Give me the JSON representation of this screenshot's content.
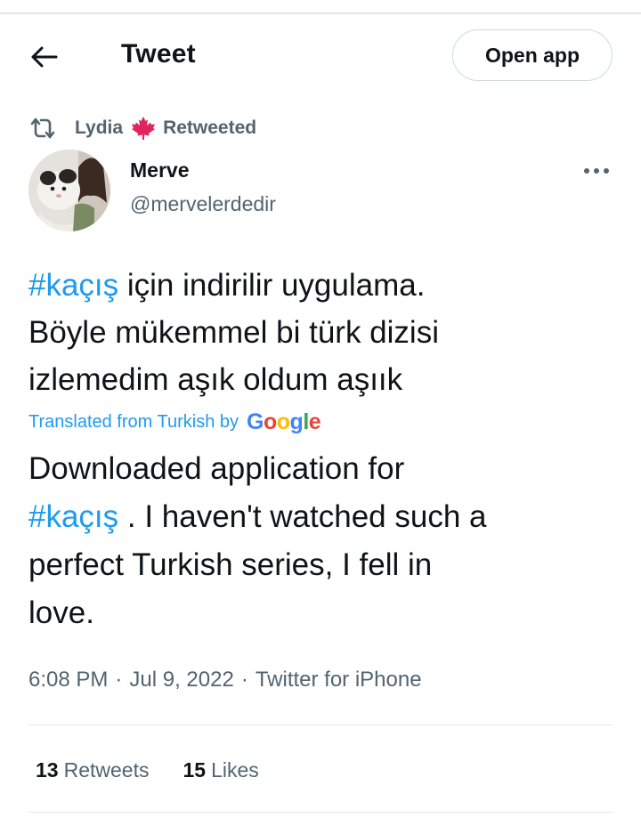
{
  "header": {
    "title": "Tweet",
    "open_app_label": "Open app"
  },
  "retweet": {
    "user": "Lydia",
    "label": "Retweeted",
    "flag_icon": "maple-leaf-icon"
  },
  "author": {
    "name": "Merve",
    "handle": "@mervelerdedir"
  },
  "tweet": {
    "hashtag": "#kaçış",
    "line1_rest": " için indirilir uygulama.",
    "line2": "Böyle mükemmel bi türk dizisi",
    "line3": "izlemedim aşık oldum aşıık"
  },
  "translation": {
    "label": "Translated from Turkish by",
    "provider": "Google",
    "line1": "Downloaded application for",
    "hashtag": "#kaçış",
    "line2_rest": " . I haven't watched such a",
    "line3": "perfect Turkish series, I fell in",
    "line4": "love."
  },
  "meta": {
    "time": "6:08 PM",
    "date": "Jul 9, 2022",
    "source": "Twitter for iPhone",
    "separator": "·"
  },
  "stats": {
    "retweets_count": "13",
    "retweets_label": "Retweets",
    "likes_count": "15",
    "likes_label": "Likes"
  },
  "colors": {
    "accent": "#1d9bf0",
    "secondary_text": "#536471",
    "maple_leaf": "#e0245e"
  }
}
